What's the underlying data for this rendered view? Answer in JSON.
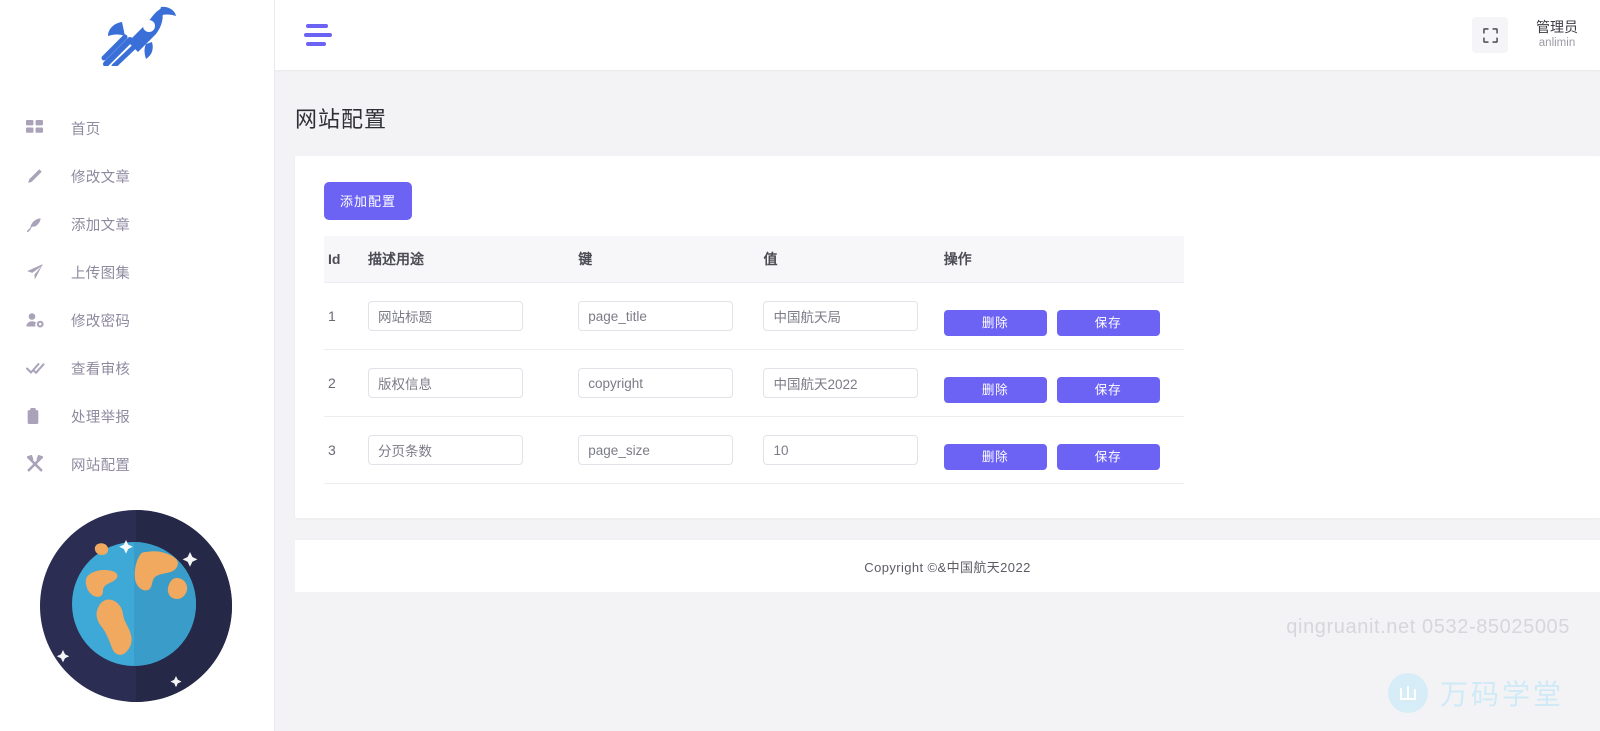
{
  "colors": {
    "accent": "#6c63f5",
    "logo_blue": "#3a6fd8",
    "page_bg": "#f3f3f5",
    "sidebar_bg": "#ffffff",
    "menu_text": "#8f8aa0",
    "watermark": "#d6d6dc"
  },
  "sidebar": {
    "logo_name": "rocket-logo",
    "items": [
      {
        "icon": "dashboard-grid-icon",
        "label": "首页"
      },
      {
        "icon": "pencil-icon",
        "label": "修改文章"
      },
      {
        "icon": "feather-icon",
        "label": "添加文章"
      },
      {
        "icon": "paper-plane-icon",
        "label": "上传图集"
      },
      {
        "icon": "user-gear-icon",
        "label": "修改密码"
      },
      {
        "icon": "double-check-icon",
        "label": "查看审核"
      },
      {
        "icon": "clipboard-icon",
        "label": "处理举报"
      },
      {
        "icon": "tools-icon",
        "label": "网站配置"
      }
    ],
    "decoration": "globe-illustration"
  },
  "topbar": {
    "menu_toggle": "hamburger-icon",
    "fullscreen": "fullscreen-icon",
    "user": {
      "name": "管理员",
      "login": "anlimin"
    }
  },
  "page": {
    "title": "网站配置",
    "add_button": "添加配置"
  },
  "table": {
    "headers": {
      "id": "Id",
      "desc": "描述用途",
      "key": "键",
      "value": "值",
      "action": "操作"
    },
    "rows": [
      {
        "id": "1",
        "desc_value": "网站标题",
        "key_value": "page_title",
        "val_value": "中国航天局",
        "delete_label": "删除",
        "save_label": "保存"
      },
      {
        "id": "2",
        "desc_value": "版权信息",
        "key_value": "copyright",
        "val_value": "中国航天2022",
        "delete_label": "删除",
        "save_label": "保存"
      },
      {
        "id": "3",
        "desc_value": "分页条数",
        "key_value": "page_size",
        "val_value": "10",
        "delete_label": "删除",
        "save_label": "保存"
      }
    ]
  },
  "footer": {
    "copyright": "Copyright ©&中国航天2022"
  },
  "watermark": {
    "contact": "qingruanit.net 0532-85025005",
    "brand": "万码学堂"
  }
}
